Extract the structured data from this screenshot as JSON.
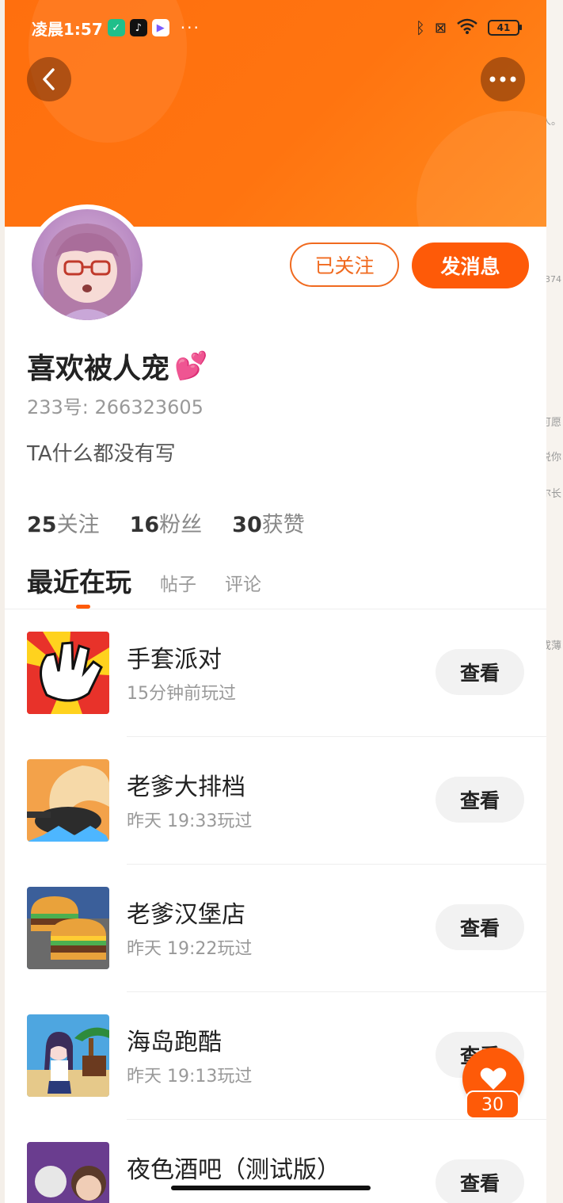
{
  "status_bar": {
    "time": "凌晨1:57",
    "battery": "41",
    "dots": "···"
  },
  "peek_text": [
    "人。",
    "374",
    "可愿",
    "说你",
    "尔长",
    "或薄"
  ],
  "profile": {
    "nickname": "喜欢被人宠",
    "nickname_emoji": "💕",
    "uid": "233号: 266323605",
    "bio": "TA什么都没有写",
    "follow_button": "已关注",
    "message_button": "发消息"
  },
  "stats": [
    {
      "num": "25",
      "label": "关注"
    },
    {
      "num": "16",
      "label": "粉丝"
    },
    {
      "num": "30",
      "label": "获赞"
    }
  ],
  "tabs": [
    "最近在玩",
    "帖子",
    "评论"
  ],
  "games": [
    {
      "name": "手套派对",
      "when": "15分钟前玩过",
      "action": "查看"
    },
    {
      "name": "老爹大排档",
      "when": "昨天 19:33玩过",
      "action": "查看"
    },
    {
      "name": "老爹汉堡店",
      "when": "昨天 19:22玩过",
      "action": "查看"
    },
    {
      "name": "海岛跑酷",
      "when": "昨天 19:13玩过",
      "action": "查看"
    },
    {
      "name": "夜色酒吧（测试版）",
      "when": "",
      "action": "查看"
    }
  ],
  "like_fab": {
    "count": "30"
  },
  "colors": {
    "accent": "#fe5a08",
    "header": "#ff7410"
  }
}
